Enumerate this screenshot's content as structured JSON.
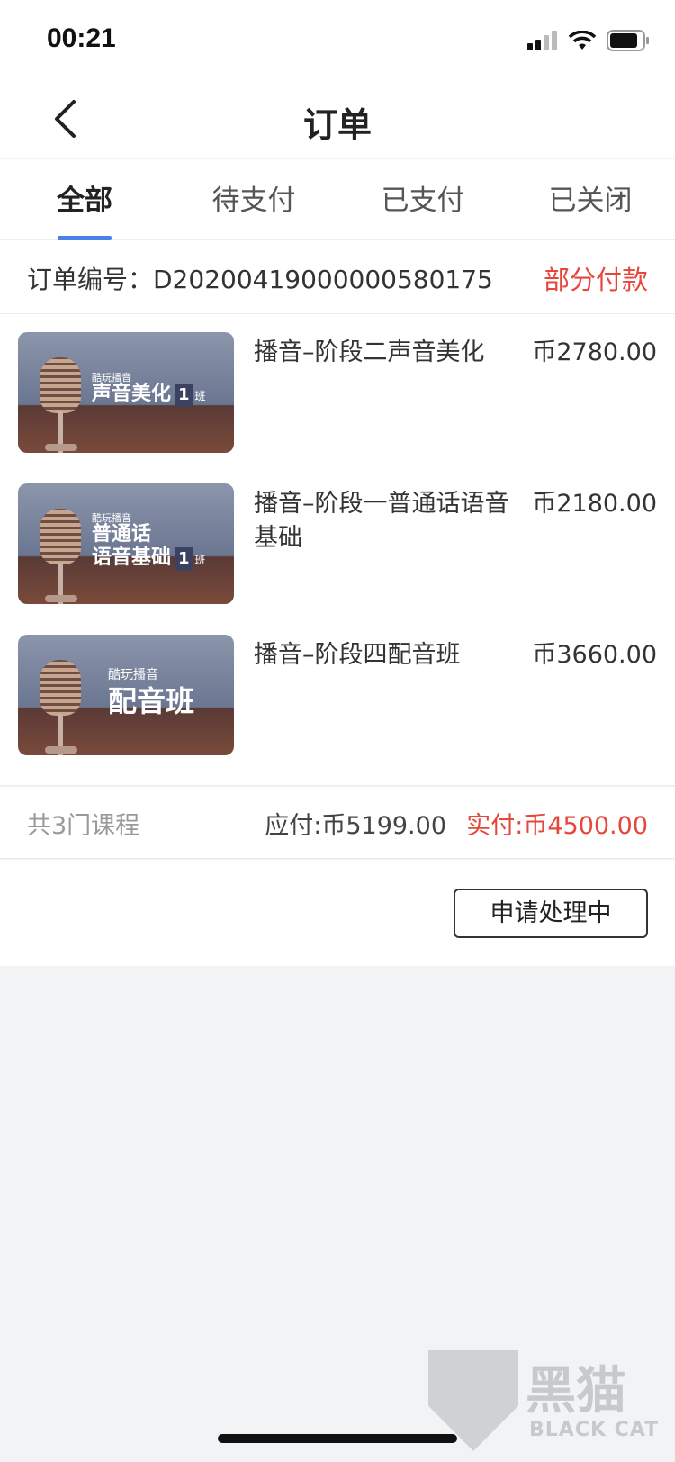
{
  "status_bar": {
    "time": "00:21"
  },
  "nav": {
    "title": "订单",
    "back_icon": "chevron-left-icon"
  },
  "tabs": [
    {
      "label": "全部",
      "active": true
    },
    {
      "label": "待支付",
      "active": false
    },
    {
      "label": "已支付",
      "active": false
    },
    {
      "label": "已关闭",
      "active": false
    }
  ],
  "order": {
    "number_label": "订单编号：D20200419000000580175",
    "status": "部分付款",
    "items": [
      {
        "name": "播音–阶段二声音美化",
        "price": "币2780.00",
        "thumb_brand": "酷玩播音",
        "thumb_title_line1": "声音美化",
        "thumb_title_line2": "",
        "thumb_class": "1",
        "thumb_ban": "班"
      },
      {
        "name": "播音–阶段一普通话语音基础",
        "price": "币2180.00",
        "thumb_brand": "酷玩播音",
        "thumb_title_line1": "普通话",
        "thumb_title_line2": "语音基础",
        "thumb_class": "1",
        "thumb_ban": "班"
      },
      {
        "name": "播音–阶段四配音班",
        "price": "币3660.00",
        "thumb_brand": "酷玩播音",
        "thumb_title_line1": "配音班",
        "thumb_title_line2": "",
        "thumb_class": "",
        "thumb_ban": ""
      }
    ],
    "course_count": "共3门课程",
    "payable": "应付:币5199.00",
    "paid": "实付:币4500.00",
    "action_label": "申请处理中"
  },
  "watermark": {
    "cn": "黑猫",
    "en": "BLACK CAT"
  },
  "colors": {
    "accent": "#4a80e8",
    "alert": "#e6473a"
  }
}
